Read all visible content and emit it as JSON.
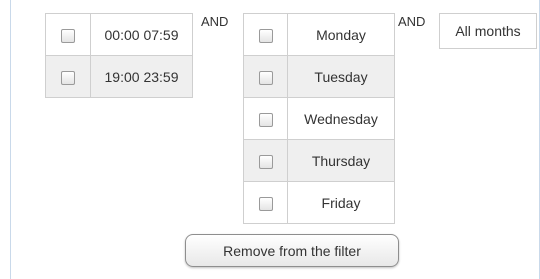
{
  "time_ranges": [
    {
      "label": "00:00 07:59"
    },
    {
      "label": "19:00 23:59"
    }
  ],
  "and_labels": [
    "AND",
    "AND"
  ],
  "days": [
    {
      "label": "Monday"
    },
    {
      "label": "Tuesday"
    },
    {
      "label": "Wednesday"
    },
    {
      "label": "Thursday"
    },
    {
      "label": "Friday"
    }
  ],
  "months": {
    "label": "All months"
  },
  "remove_button": {
    "label": "Remove from the filter"
  }
}
